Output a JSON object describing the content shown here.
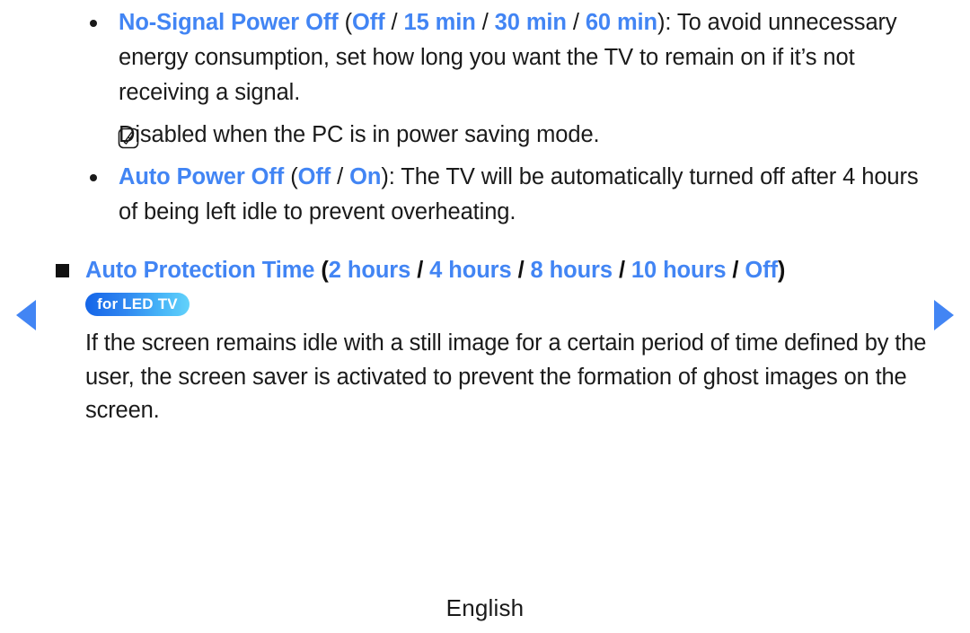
{
  "nav": {
    "prev_label": "Previous page",
    "next_label": "Next page"
  },
  "content": {
    "items": [
      {
        "bullet": "dot",
        "title": "No-Signal Power Off",
        "open_paren": "(",
        "options": [
          "Off",
          "15 min",
          "30 min",
          "60 min"
        ],
        "separator": " / ",
        "close_paren": ")",
        "description": ": To avoid unnecessary energy consumption, set how long you want the TV to remain on if it’s not receiving a signal."
      },
      {
        "bullet": "note",
        "icon": "note-icon",
        "text": "Disabled when the PC is in power saving mode."
      },
      {
        "bullet": "dot",
        "title": "Auto Power Off",
        "open_paren": "(",
        "options": [
          "Off",
          "On"
        ],
        "separator": " / ",
        "close_paren": ")",
        "description": ": The TV will be automatically turned off after 4 hours of being left idle to prevent overheating."
      },
      {
        "bullet": "square",
        "title": "Auto Protection Time",
        "open_paren": "(",
        "options": [
          "2 hours",
          "4 hours",
          "8 hours",
          "10 hours",
          "Off"
        ],
        "separator": " / ",
        "close_paren": ")",
        "badge": "for LED TV",
        "description": "If the screen remains idle with a still image for a certain period of time defined by the user, the screen saver is activated to prevent the formation of ghost images on the screen."
      }
    ]
  },
  "footer": {
    "language": "English"
  },
  "colors": {
    "accent_blue": "#4285f4",
    "text": "#1a1a1a",
    "badge_gradient_start": "#1565e8",
    "badge_gradient_end": "#62d2fb",
    "background": "#ffffff"
  }
}
